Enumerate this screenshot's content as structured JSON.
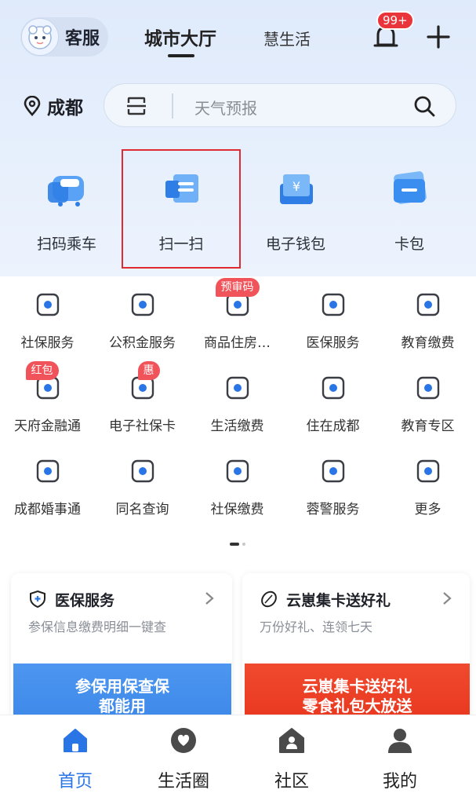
{
  "header": {
    "service_label": "客服",
    "tabs": [
      {
        "label": "城市大厅",
        "active": true
      },
      {
        "label": "慧生活",
        "active": false
      }
    ],
    "notification_badge": "99+"
  },
  "location": {
    "city": "成都"
  },
  "search": {
    "placeholder": "天气预报"
  },
  "quick_actions": [
    {
      "label": "扫码乘车",
      "icon": "bus-qr-icon"
    },
    {
      "label": "扫一扫",
      "icon": "scan-icon",
      "highlighted": true
    },
    {
      "label": "电子钱包",
      "icon": "wallet-icon"
    },
    {
      "label": "卡包",
      "icon": "card-icon"
    }
  ],
  "services": [
    {
      "label": "社保服务",
      "icon": "social-security-icon"
    },
    {
      "label": "公积金服务",
      "icon": "housing-fund-icon"
    },
    {
      "label": "商品住房…",
      "icon": "housing-icon",
      "tag": "预审码"
    },
    {
      "label": "医保服务",
      "icon": "medical-insurance-icon"
    },
    {
      "label": "教育缴费",
      "icon": "education-fee-icon"
    },
    {
      "label": "天府金融通",
      "icon": "finance-icon",
      "tag": "红包"
    },
    {
      "label": "电子社保卡",
      "icon": "e-social-card-icon",
      "tag": "惠"
    },
    {
      "label": "生活缴费",
      "icon": "utility-fee-icon"
    },
    {
      "label": "住在成都",
      "icon": "living-icon"
    },
    {
      "label": "教育专区",
      "icon": "education-zone-icon"
    },
    {
      "label": "成都婚事通",
      "icon": "marriage-icon"
    },
    {
      "label": "同名查询",
      "icon": "name-query-icon"
    },
    {
      "label": "社保缴费",
      "icon": "social-fee-icon"
    },
    {
      "label": "蓉警服务",
      "icon": "police-icon"
    },
    {
      "label": "更多",
      "icon": "more-grid-icon"
    }
  ],
  "cards": [
    {
      "title": "医保服务",
      "subtitle": "参保信息缴费明细一键查",
      "banner_line1": "参保用保查保",
      "banner_line2": "都能用"
    },
    {
      "title": "云崽集卡送好礼",
      "subtitle": "万份好礼、连领七天",
      "banner_line1": "云崽集卡送好礼",
      "banner_line2": "零食礼包大放送"
    }
  ],
  "bottom_nav": [
    {
      "label": "首页",
      "active": true
    },
    {
      "label": "生活圈",
      "active": false
    },
    {
      "label": "社区",
      "active": false
    },
    {
      "label": "我的",
      "active": false
    }
  ],
  "colors": {
    "accent": "#2a75e6",
    "highlight_border": "#e02a33",
    "badge_red": "#e8343a"
  }
}
